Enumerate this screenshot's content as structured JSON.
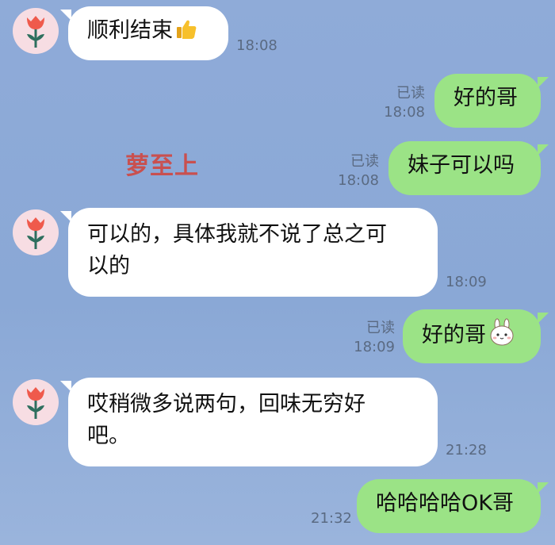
{
  "messages": [
    {
      "side": "in",
      "text": "顺利结束",
      "emoji": "thumbs-up",
      "time": "18:08"
    },
    {
      "side": "out",
      "text": "好的哥",
      "read": "已读",
      "time": "18:08"
    },
    {
      "side": "out",
      "text": "妹子可以吗",
      "read": "已读",
      "time": "18:08"
    },
    {
      "side": "in",
      "text": "可以的，具体我就不说了总之可以的",
      "line1": "可以的，具体我就不说了总之可",
      "line2": "以的",
      "time": "18:09"
    },
    {
      "side": "out",
      "text": "好的哥",
      "emoji": "bunny",
      "read": "已读",
      "time": "18:09"
    },
    {
      "side": "in",
      "text": "哎稍微多说两句，回味无穷好吧。",
      "line1": "哎稍微多说两句，回味无穷好",
      "line2": "吧。",
      "time": "21:28"
    },
    {
      "side": "out",
      "text": "哈哈哈哈OK哥",
      "time": "21:32"
    }
  ],
  "watermark": "萝至上",
  "colors": {
    "background": "#8fabd8",
    "incoming_bubble": "#ffffff",
    "outgoing_bubble": "#9be386",
    "watermark": "#c9504f",
    "avatar_bg": "#f7dde3"
  }
}
